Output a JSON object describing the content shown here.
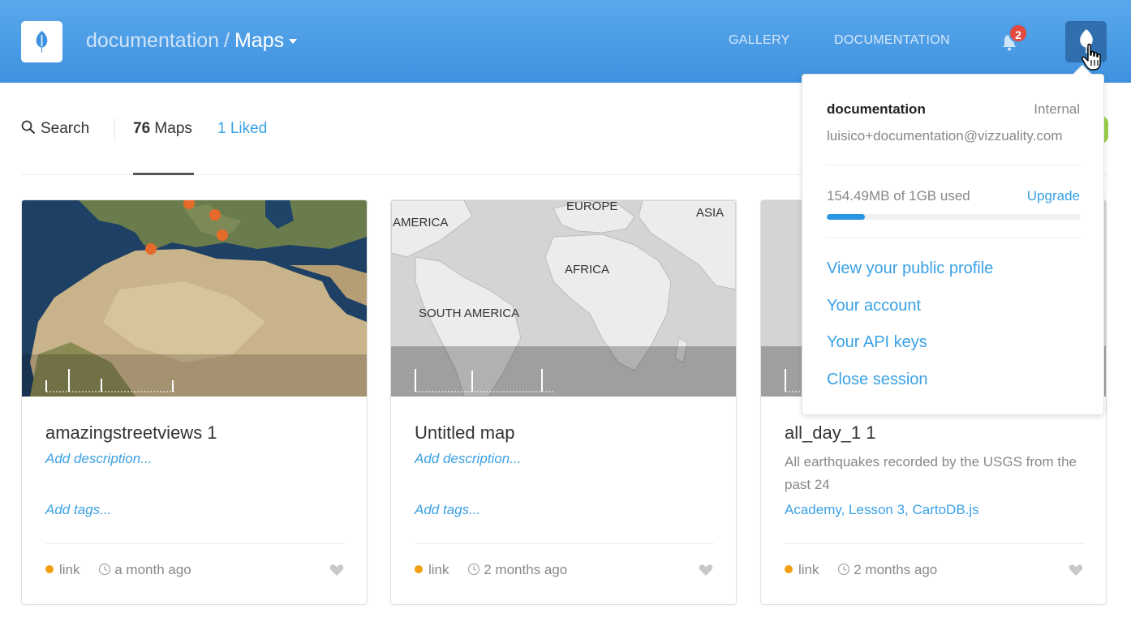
{
  "header": {
    "breadcrumb_user": "documentation",
    "breadcrumb_sep": "/",
    "breadcrumb_current": "Maps",
    "nav_gallery": "GALLERY",
    "nav_documentation": "DOCUMENTATION",
    "notifications_count": "2",
    "icons": [
      "carto-leaf-logo-icon",
      "bell-icon",
      "avatar-leaf-icon",
      "caret-down-icon"
    ]
  },
  "filters": {
    "search_label": "Search",
    "maps_count": "76",
    "maps_label": "Maps",
    "liked_label": "1 Liked"
  },
  "cards": [
    {
      "title": "amazingstreetviews 1",
      "description": "Add description...",
      "tags": "Add tags...",
      "privacy": "link",
      "updated": "a month ago"
    },
    {
      "title": "Untitled map",
      "description": "Add description...",
      "tags": "Add tags...",
      "privacy": "link",
      "updated": "2 months ago",
      "map_labels": {
        "europe": "EUROPE",
        "asia": "ASIA",
        "america": "AMERICA",
        "africa": "AFRICA",
        "south_america": "SOUTH AMERICA"
      }
    },
    {
      "title": "all_day_1 1",
      "description": "All earthquakes recorded by the USGS from the past 24",
      "tags": "Academy, Lesson 3, CartoDB.js",
      "privacy": "link",
      "updated": "2 months ago"
    }
  ],
  "dropdown": {
    "username": "documentation",
    "account_type": "Internal",
    "email": "luisico+documentation@vizzuality.com",
    "usage": "154.49MB of 1GB used",
    "usage_fraction": 0.15,
    "upgrade": "Upgrade",
    "links": [
      "View your public profile",
      "Your account",
      "Your API keys",
      "Close session"
    ]
  },
  "colors": {
    "header": "#4a9be6",
    "link": "#3aa1e5",
    "privacy_dot": "#f0a010",
    "badge": "#e34a3d"
  }
}
